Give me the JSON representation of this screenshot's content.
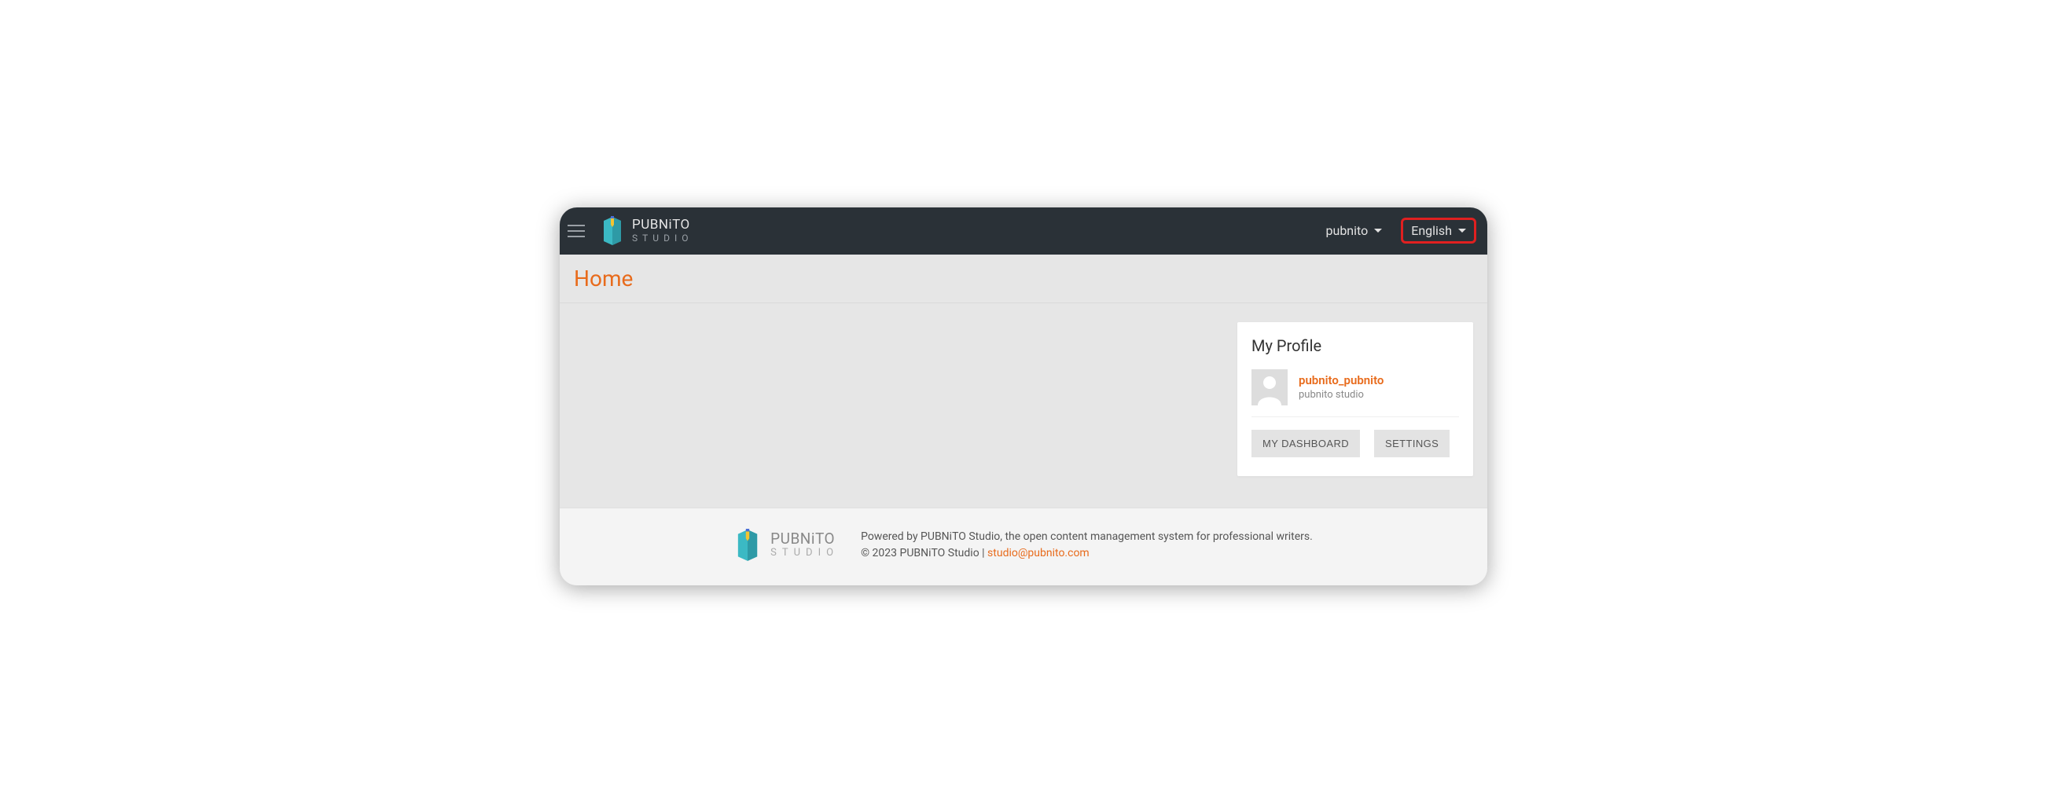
{
  "brand": {
    "top": "PUBNiTO",
    "bottom": "STUDIO"
  },
  "topbar": {
    "user_label": "pubnito",
    "lang_label": "English"
  },
  "page": {
    "title": "Home"
  },
  "profile": {
    "heading": "My Profile",
    "username": "pubnito_pubnito",
    "org": "pubnito studio",
    "dashboard_btn": "MY DASHBOARD",
    "settings_btn": "SETTINGS"
  },
  "footer": {
    "line1": "Powered by PUBNiTO Studio, the open content management system for professional writers.",
    "copyright_prefix": "© 2023 PUBNiTO Studio | ",
    "email": "studio@pubnito.com"
  }
}
